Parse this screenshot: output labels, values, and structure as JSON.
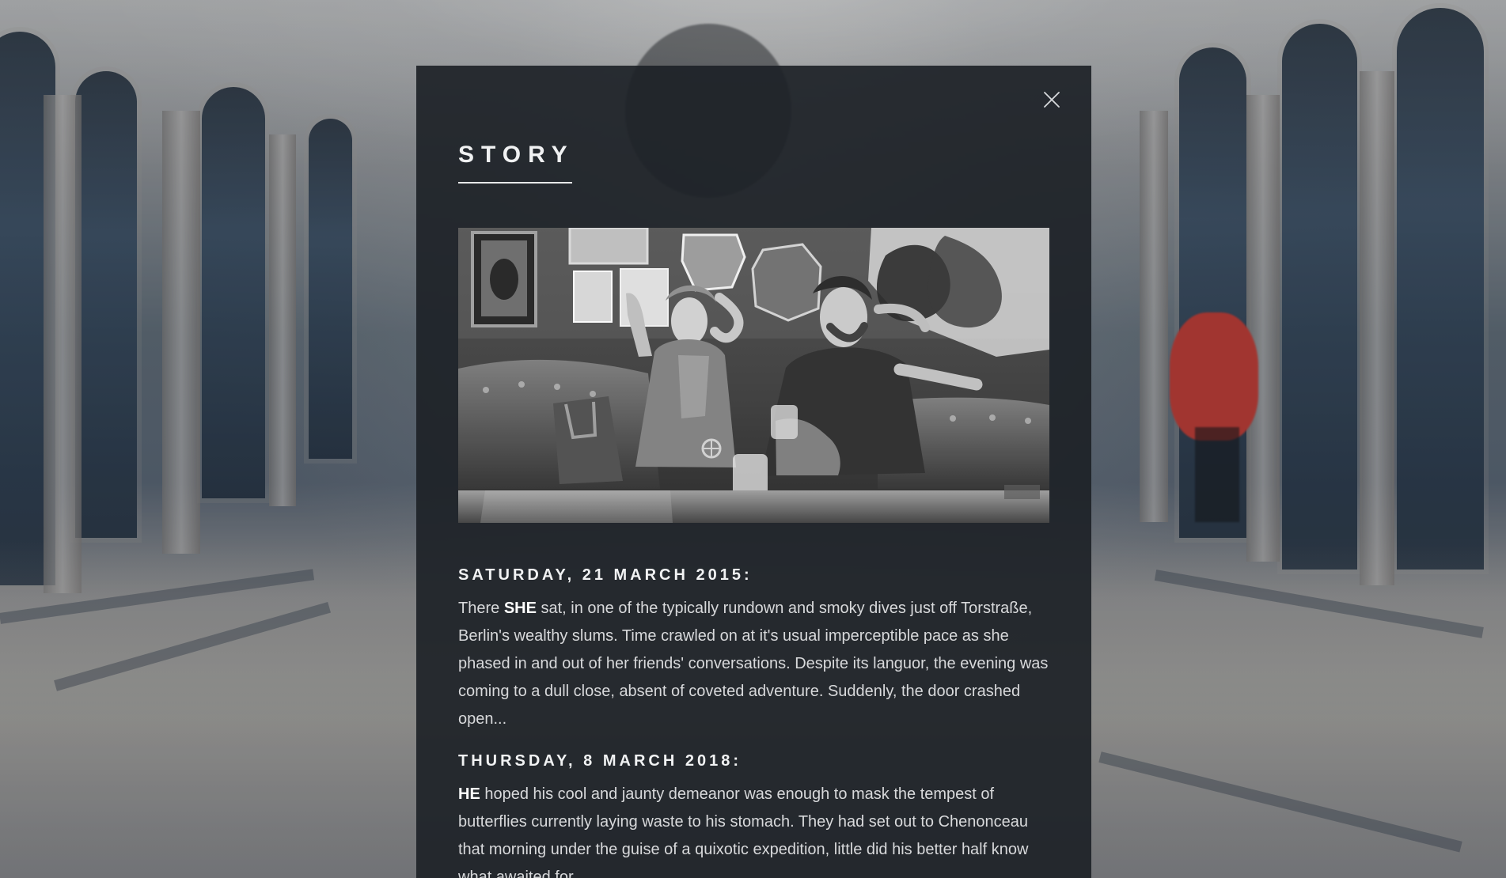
{
  "modal": {
    "title": "STORY",
    "close_icon": "close-icon",
    "image_alt": "Black-and-white photo of a woman and man seated on a leather sofa in a bar",
    "entries": [
      {
        "date": "SATURDAY, 21 MARCH 2015:",
        "paragraph_prefix": "There ",
        "highlight": "SHE",
        "paragraph_suffix": " sat, in one of the typically rundown and smoky dives just off Torstraße, Berlin's wealthy slums. Time crawled on at it's usual imperceptible pace as she phased in and out of her friends' conversations. Despite its languor, the evening was coming to a dull close, absent of coveted adventure. Suddenly, the door crashed open..."
      },
      {
        "date": "THURSDAY, 8 MARCH 2018:",
        "paragraph_prefix": "",
        "highlight": "HE",
        "paragraph_suffix": " hoped his cool and jaunty demeanor was enough to mask the tempest of butterflies currently laying waste to his stomach. They had set out to Chenonceau that morning under the guise of a quixotic expedition, little did his better half know what awaited for"
      }
    ]
  },
  "colors": {
    "modal_bg": "#1d2227",
    "text": "#d8d9db",
    "heading": "#f0f1f2"
  }
}
